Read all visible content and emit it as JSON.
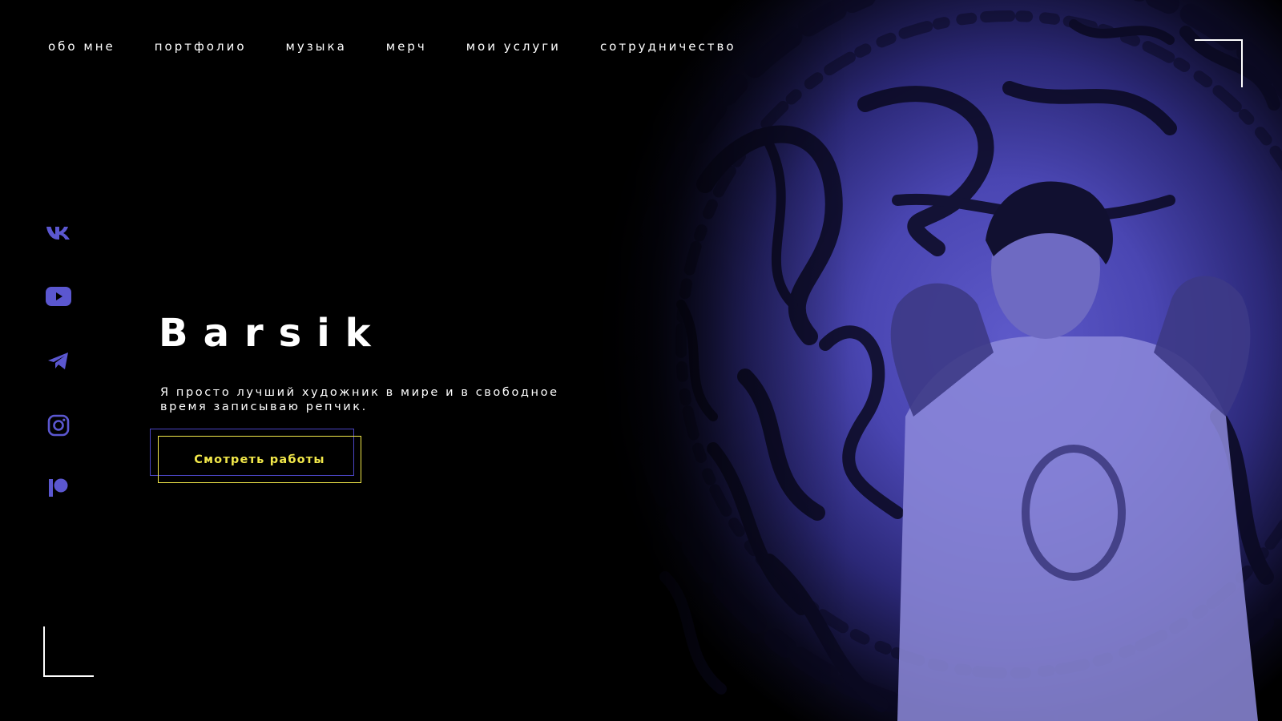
{
  "nav": {
    "items": [
      {
        "label": "обо мне"
      },
      {
        "label": "портфолио"
      },
      {
        "label": "музыка"
      },
      {
        "label": "мерч"
      },
      {
        "label": "мои услуги"
      },
      {
        "label": "сотрудничество"
      }
    ]
  },
  "hero": {
    "title": "Barsik",
    "subtitle": "Я просто лучший художник в мире и в свободное время записываю репчик.",
    "cta_label": "Смотреть работы"
  },
  "social": {
    "items": [
      {
        "icon": "vk-icon"
      },
      {
        "icon": "youtube-icon"
      },
      {
        "icon": "telegram-icon"
      },
      {
        "icon": "instagram-icon"
      },
      {
        "icon": "patreon-icon"
      }
    ]
  },
  "colors": {
    "background": "#000000",
    "accent_purple": "#5b57d0",
    "cta_yellow": "#f2e84a",
    "frame_blue": "#4b45c4",
    "text": "#ffffff"
  }
}
